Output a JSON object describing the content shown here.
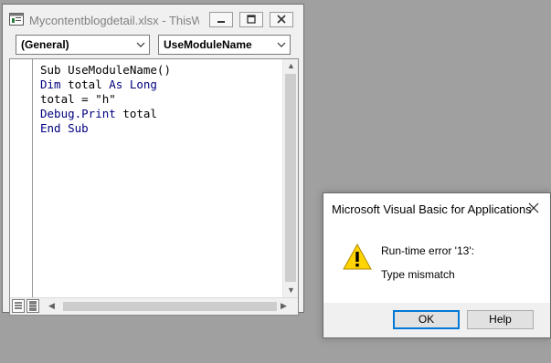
{
  "vbe_window": {
    "title": "Mycontentblogdetail.xlsx - ThisW...",
    "object_combo": "(General)",
    "procedure_combo": "UseModuleName",
    "code_lines": [
      [
        {
          "t": "Sub UseModuleName()",
          "kw": false
        }
      ],
      [
        {
          "t": "Dim",
          "kw": true
        },
        {
          "t": " total ",
          "kw": false
        },
        {
          "t": "As Long",
          "kw": true
        }
      ],
      [
        {
          "t": "total = \"h\"",
          "kw": false
        }
      ],
      [
        {
          "t": "Debug.Print",
          "kw": true
        },
        {
          "t": " total",
          "kw": false
        }
      ],
      [
        {
          "t": "End Sub",
          "kw": true
        }
      ]
    ]
  },
  "dialog": {
    "title": "Microsoft Visual Basic for Applications",
    "message_line1": "Run-time error '13':",
    "message_line2": "Type mismatch",
    "ok_label": "OK",
    "help_label": "Help",
    "icon": "warning-icon"
  },
  "colors": {
    "desktop": "#a0a0a0",
    "keyword": "#00007f",
    "warning_fill": "#ffd400",
    "default_button_border": "#0078d7"
  }
}
